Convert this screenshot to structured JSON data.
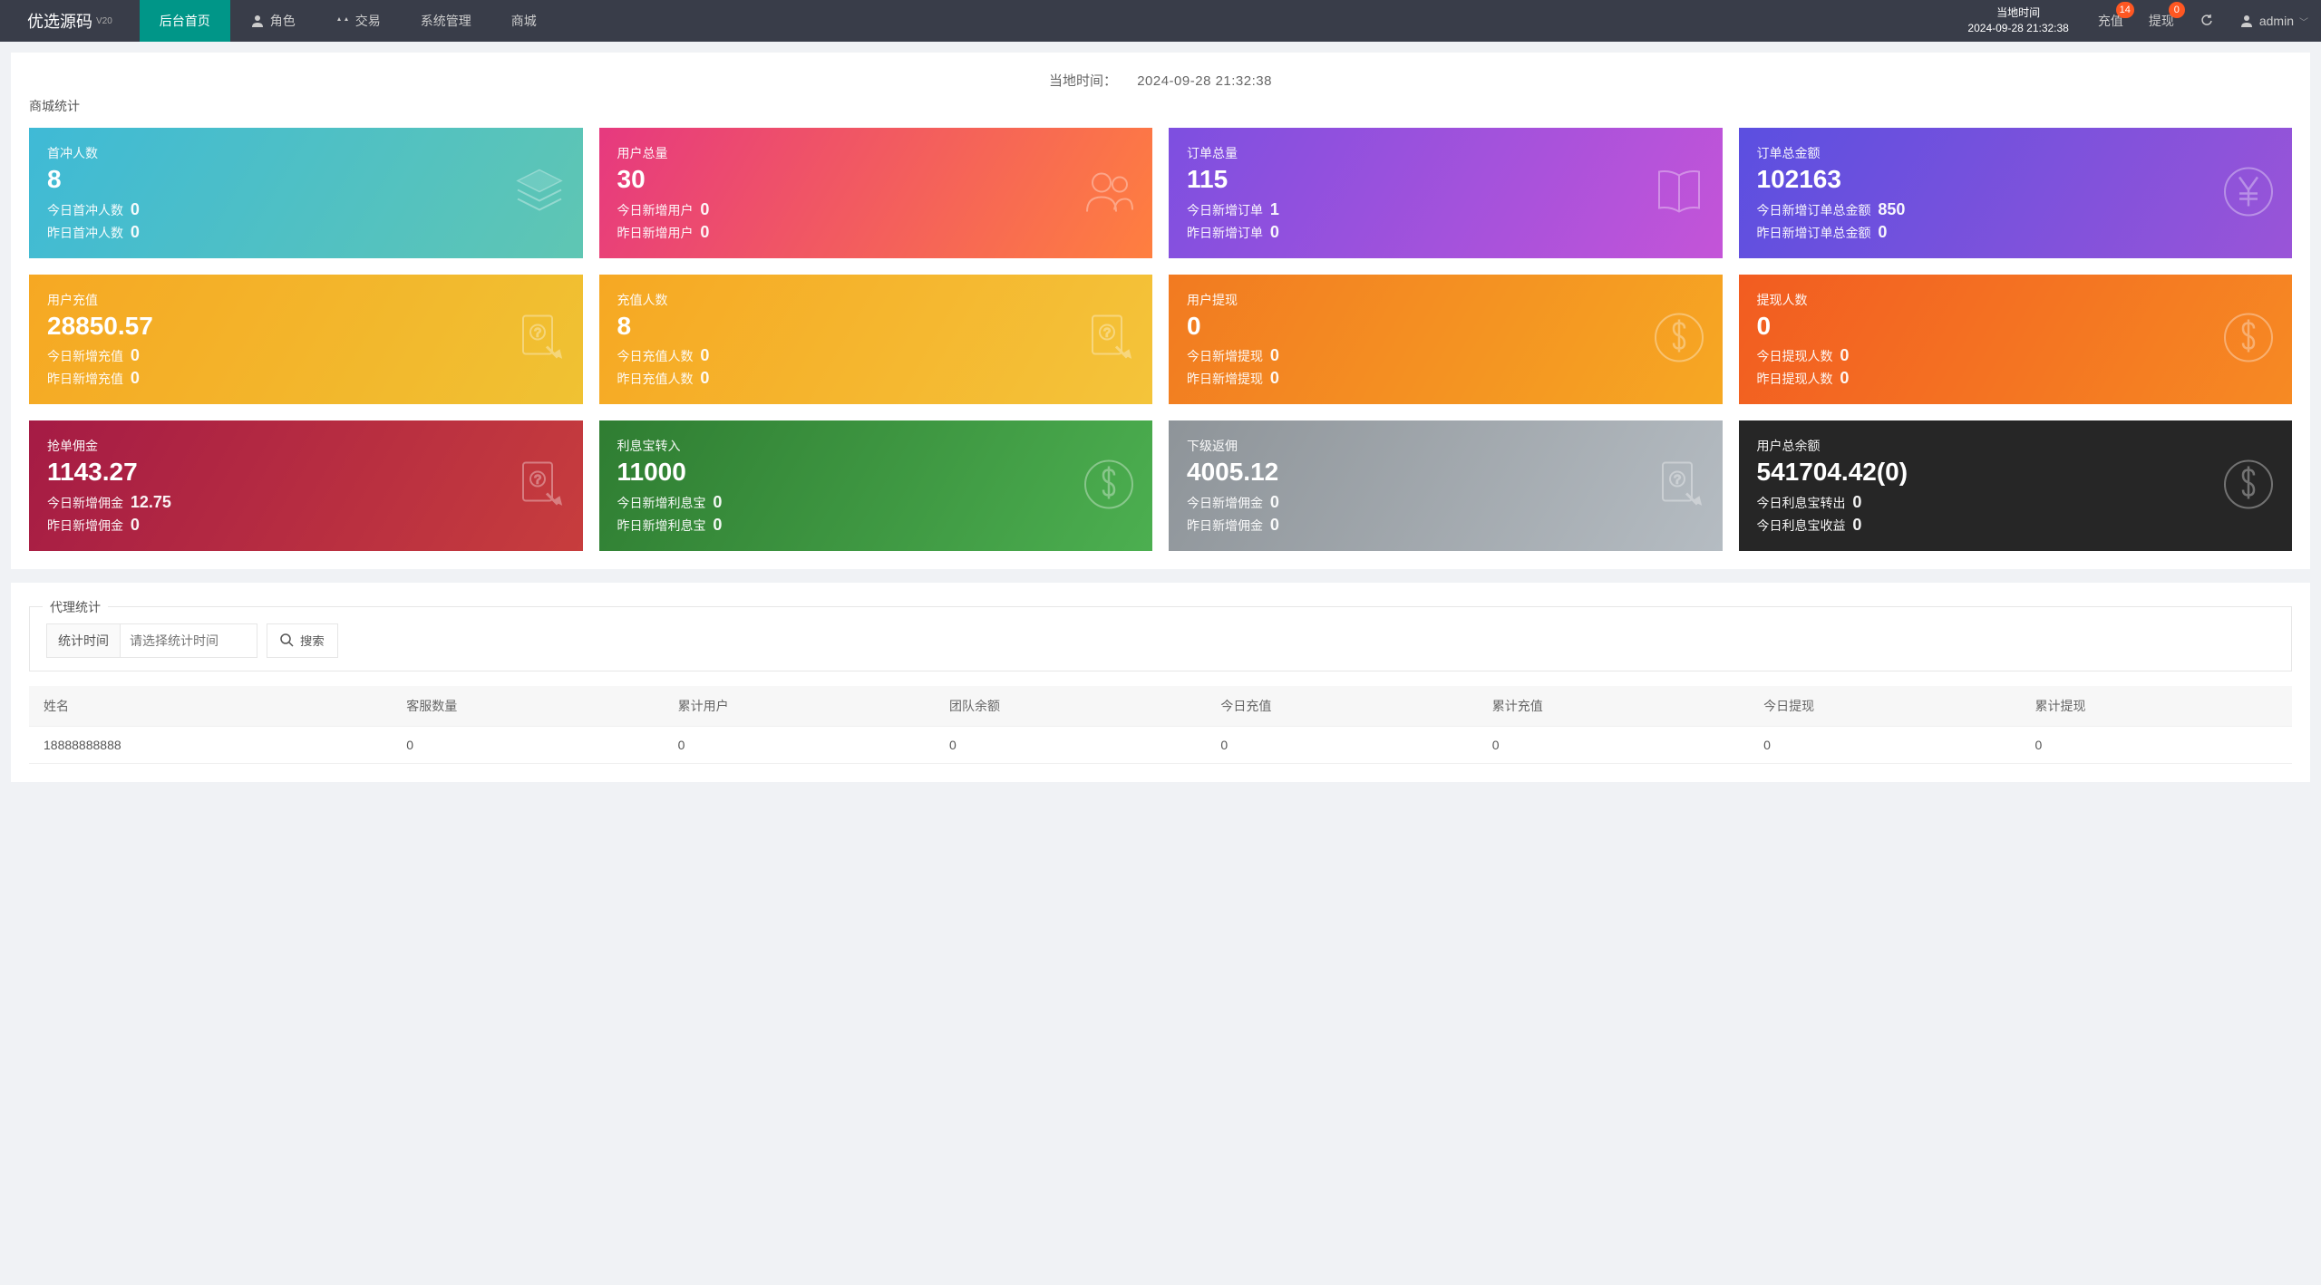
{
  "brand": {
    "name": "优选源码",
    "ver": "V20"
  },
  "nav": {
    "items": [
      {
        "label": "后台首页",
        "active": true
      },
      {
        "label": "角色"
      },
      {
        "label": "交易"
      },
      {
        "label": "系统管理"
      },
      {
        "label": "商城"
      }
    ],
    "time_label": "当地时间",
    "time_value": "2024-09-28 21:32:38",
    "recharge": {
      "label": "充值",
      "badge": "14"
    },
    "withdraw": {
      "label": "提现",
      "badge": "0"
    },
    "user": "admin"
  },
  "localtime": {
    "label": "当地时间：",
    "value": "2024-09-28 21:32:38"
  },
  "section1_title": "商城统计",
  "cards": [
    {
      "title": "首冲人数",
      "big": "8",
      "r1l": "今日首冲人数",
      "r1v": "0",
      "r2l": "昨日首冲人数",
      "r2v": "0",
      "cls": "g-teal",
      "icon": "layers"
    },
    {
      "title": "用户总量",
      "big": "30",
      "r1l": "今日新增用户",
      "r1v": "0",
      "r2l": "昨日新增用户",
      "r2v": "0",
      "cls": "g-pink",
      "icon": "users"
    },
    {
      "title": "订单总量",
      "big": "115",
      "r1l": "今日新增订单",
      "r1v": "1",
      "r2l": "昨日新增订单",
      "r2v": "0",
      "cls": "g-purple",
      "icon": "book"
    },
    {
      "title": "订单总金额",
      "big": "102163",
      "r1l": "今日新增订单总金额",
      "r1v": "850",
      "r2l": "昨日新增订单总金额",
      "r2v": "0",
      "cls": "g-indigo",
      "icon": "yen"
    },
    {
      "title": "用户充值",
      "big": "28850.57",
      "r1l": "今日新增充值",
      "r1v": "0",
      "r2l": "昨日新增充值",
      "r2v": "0",
      "cls": "g-yellow",
      "icon": "doc"
    },
    {
      "title": "充值人数",
      "big": "8",
      "r1l": "今日充值人数",
      "r1v": "0",
      "r2l": "昨日充值人数",
      "r2v": "0",
      "cls": "g-amber",
      "icon": "doc"
    },
    {
      "title": "用户提现",
      "big": "0",
      "r1l": "今日新增提现",
      "r1v": "0",
      "r2l": "昨日新增提现",
      "r2v": "0",
      "cls": "g-orangeA",
      "icon": "dollar"
    },
    {
      "title": "提现人数",
      "big": "0",
      "r1l": "今日提现人数",
      "r1v": "0",
      "r2l": "昨日提现人数",
      "r2v": "0",
      "cls": "g-orangeB",
      "icon": "dollar"
    },
    {
      "title": "抢单佣金",
      "big": "1143.27",
      "r1l": "今日新增佣金",
      "r1v": "12.75",
      "r2l": "昨日新增佣金",
      "r2v": "0",
      "cls": "g-maroon",
      "icon": "doc"
    },
    {
      "title": "利息宝转入",
      "big": "11000",
      "r1l": "今日新增利息宝",
      "r1v": "0",
      "r2l": "昨日新增利息宝",
      "r2v": "0",
      "cls": "g-green",
      "icon": "dollar"
    },
    {
      "title": "下级返佣",
      "big": "4005.12",
      "r1l": "今日新增佣金",
      "r1v": "0",
      "r2l": "昨日新增佣金",
      "r2v": "0",
      "cls": "g-gray",
      "icon": "doc"
    },
    {
      "title": "用户总余额",
      "big": "541704.42(0)",
      "r1l": "今日利息宝转出",
      "r1v": "0",
      "r2l": "今日利息宝收益",
      "r2v": "0",
      "cls": "g-dark",
      "icon": "dollar"
    }
  ],
  "agent": {
    "legend": "代理统计",
    "time_label": "统计时间",
    "placeholder": "请选择统计时间",
    "search_btn": "搜索",
    "columns": [
      "姓名",
      "客服数量",
      "累计用户",
      "团队余额",
      "今日充值",
      "累计充值",
      "今日提现",
      "累计提现"
    ],
    "row": [
      "18888888888",
      "0",
      "0",
      "0",
      "0",
      "0",
      "0",
      "0"
    ]
  }
}
